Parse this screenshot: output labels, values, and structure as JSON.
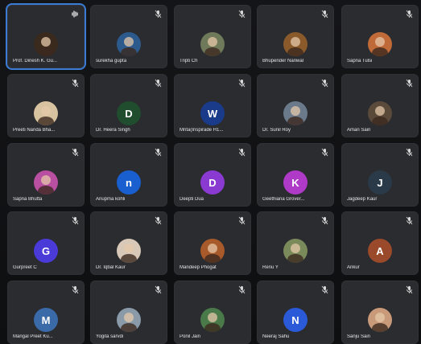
{
  "participants": [
    {
      "name": "Prof. Dinesh K. Gu...",
      "avatar": {
        "type": "photo",
        "color": "#3a2a1e"
      },
      "speaking": true
    },
    {
      "name": "surekha gupta",
      "avatar": {
        "type": "photo",
        "color": "#2d5a8c"
      }
    },
    {
      "name": "Tripti Ch",
      "avatar": {
        "type": "photo",
        "color": "#6f7a5a"
      }
    },
    {
      "name": "Bhupender Nanwal",
      "avatar": {
        "type": "photo",
        "color": "#8a5a2a"
      }
    },
    {
      "name": "Sapna Tulsi",
      "avatar": {
        "type": "photo",
        "color": "#c06a3a"
      }
    },
    {
      "name": "Preeti Nanda Bha...",
      "avatar": {
        "type": "photo",
        "color": "#d8c3a0"
      }
    },
    {
      "name": "Dr. Heera Singh",
      "avatar": {
        "type": "letter",
        "letter": "D",
        "color": "#1f4d2e"
      }
    },
    {
      "name": "Mrita(Inspirade H1...",
      "avatar": {
        "type": "letter",
        "letter": "W",
        "color": "#1a3a8a"
      }
    },
    {
      "name": "Dr. Sunil Roy",
      "avatar": {
        "type": "photo",
        "color": "#6a7a8a"
      }
    },
    {
      "name": "Aman Sain",
      "avatar": {
        "type": "photo",
        "color": "#5a4a3a"
      }
    },
    {
      "name": "Sapna Bhutta",
      "avatar": {
        "type": "photo",
        "color": "#b84fa0"
      }
    },
    {
      "name": "Anupma kohli",
      "avatar": {
        "type": "letter",
        "letter": "n",
        "color": "#1a5fd0"
      }
    },
    {
      "name": "Deepti Dua",
      "avatar": {
        "type": "letter",
        "letter": "D",
        "color": "#8a3ad0"
      }
    },
    {
      "name": "Geethiana Grover...",
      "avatar": {
        "type": "letter",
        "letter": "K",
        "color": "#b03ac8"
      }
    },
    {
      "name": "Jagdeep Kaur",
      "avatar": {
        "type": "letter",
        "letter": "J",
        "color": "#2a3a48"
      }
    },
    {
      "name": "Gurpreet C",
      "avatar": {
        "type": "letter",
        "letter": "G",
        "color": "#4a3ad8"
      }
    },
    {
      "name": "Dr. Iqbal Kaur",
      "avatar": {
        "type": "photo",
        "color": "#d8c8b8"
      }
    },
    {
      "name": "Mandeep Phogat",
      "avatar": {
        "type": "photo",
        "color": "#a85a2a"
      }
    },
    {
      "name": "Renu Y",
      "avatar": {
        "type": "photo",
        "color": "#7a8a5a"
      }
    },
    {
      "name": "Ankur",
      "avatar": {
        "type": "letter",
        "letter": "A",
        "color": "#9a4a2a"
      }
    },
    {
      "name": "Mangal Preet Ku...",
      "avatar": {
        "type": "letter",
        "letter": "M",
        "color": "#3a6aa8"
      }
    },
    {
      "name": "Yogita sarvdi",
      "avatar": {
        "type": "photo",
        "color": "#8a9aa8"
      }
    },
    {
      "name": "Ponil Jain",
      "avatar": {
        "type": "photo",
        "color": "#4a7a4a"
      }
    },
    {
      "name": "Neeraj Sahu",
      "avatar": {
        "type": "letter",
        "letter": "N",
        "color": "#2a5ad8"
      }
    },
    {
      "name": "Sanju Sain",
      "avatar": {
        "type": "photo",
        "color": "#c89a7a"
      }
    }
  ],
  "ui": {
    "mic_icon": "mic-off-icon",
    "active_mic_icon": "sound-icon",
    "accent": "#3a7bd5",
    "tile_bg": "#2a2c30"
  }
}
